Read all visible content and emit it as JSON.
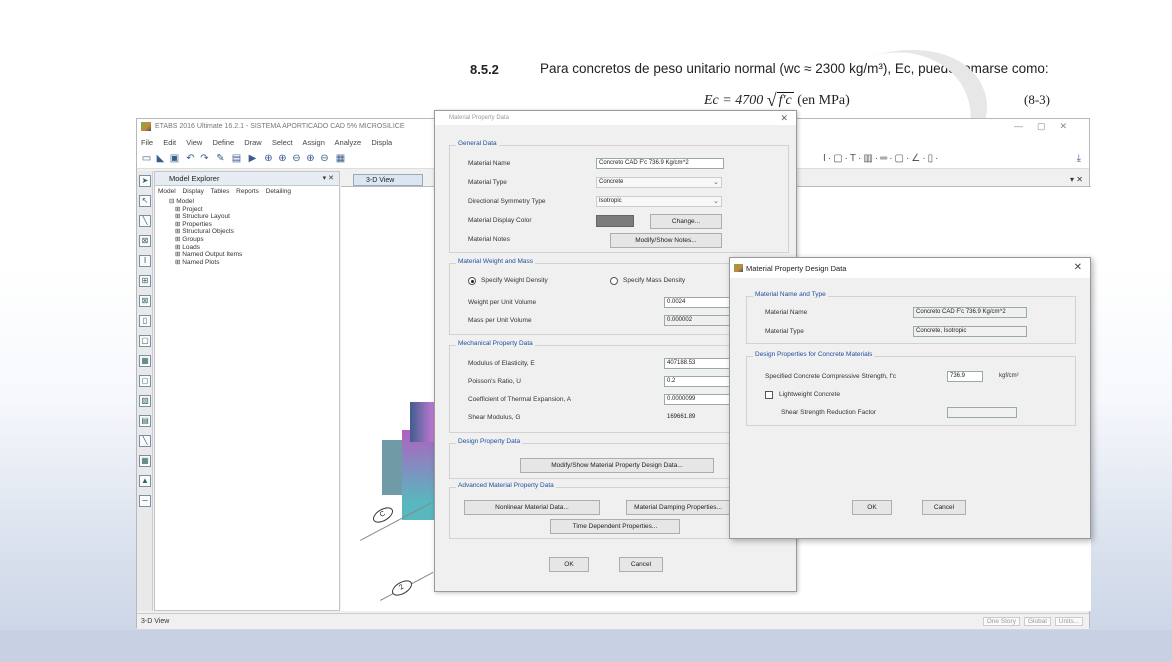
{
  "formula": {
    "section": "8.5.2",
    "text": "Para concretos de peso unitario normal (wc ≈ 2300 kg/m³), Ec, puede tomarse como:",
    "eq_left": "Ec = 4700 ",
    "eq_radical": "√",
    "eq_radicand": "f′c",
    "eq_unit": "  (en MPa)",
    "eq_ref": "(8-3)"
  },
  "etabs": {
    "title": "ETABS 2016 Ultimate 16.2.1 - SISTEMA APORTICADO CAD 5% MICROSILICE",
    "menu": [
      "File",
      "Edit",
      "View",
      "Define",
      "Draw",
      "Select",
      "Assign",
      "Analyze",
      "Displa"
    ],
    "explorer_title": "Model Explorer",
    "explorer_tabs": [
      "Model",
      "Display",
      "Tables",
      "Reports",
      "Detailing"
    ],
    "tree_root": "Model",
    "tree_items": [
      "Project",
      "Structure Layout",
      "Properties",
      "Structural Objects",
      "Groups",
      "Loads",
      "Named Output Items",
      "Named Plots"
    ],
    "view_tab": "3-D View",
    "status_left": "3-D View",
    "status_right": [
      "One Story",
      "Global",
      "Units..."
    ],
    "bubbles": [
      "C",
      "2"
    ]
  },
  "mpd": {
    "title": "Material Property Data",
    "general_group": "General Data",
    "material_name_label": "Material Name",
    "material_name_value": "Concreto CAD F'c 736.9 Kg/cm^2",
    "material_type_label": "Material Type",
    "material_type_value": "Concrete",
    "dir_sym_label": "Directional Symmetry Type",
    "dir_sym_value": "Isotropic",
    "display_color_label": "Material Display Color",
    "change_btn": "Change...",
    "notes_label": "Material Notes",
    "notes_btn": "Modify/Show Notes...",
    "weight_group": "Material Weight and Mass",
    "specify_weight": "Specify Weight Density",
    "specify_mass": "Specify Mass Density",
    "weight_label": "Weight per Unit Volume",
    "weight_value": "0.0024",
    "mass_label": "Mass per Unit Volume",
    "mass_value": "0.000002",
    "mech_group": "Mechanical Property Data",
    "modulus_label": "Modulus of Elasticity,  E",
    "modulus_value": "407188.53",
    "poisson_label": "Poisson's Ratio,  U",
    "poisson_value": "0.2",
    "thermal_label": "Coefficient of Thermal Expansion,  A",
    "thermal_value": "0.0000099",
    "shear_label": "Shear Modulus,  G",
    "shear_value": "169661.89",
    "unit_k": "k",
    "unit_1": "1",
    "design_group": "Design Property Data",
    "design_btn": "Modify/Show Material Property Design Data...",
    "advanced_group": "Advanced Material Property Data",
    "nonlinear_btn": "Nonlinear Material Data...",
    "damping_btn": "Material Damping Properties...",
    "time_btn": "Time Dependent Properties...",
    "ok": "OK",
    "cancel": "Cancel"
  },
  "mdd": {
    "title": "Material Property Design Data",
    "name_group": "Material Name and Type",
    "name_label": "Material Name",
    "name_value": "Concreto CAD F'c 736.9 Kg/cm^2",
    "type_label": "Material Type",
    "type_value": "Concrete, Isotropic",
    "design_group": "Design Properties for Concrete Materials",
    "fc_label": "Specified Concrete Compressive Strength, f'c",
    "fc_value": "736.9",
    "fc_unit": "kgf/cm²",
    "lightweight_label": "Lightweight Concrete",
    "shear_factor_label": "Shear Strength Reduction Factor",
    "ok": "OK",
    "cancel": "Cancel"
  }
}
